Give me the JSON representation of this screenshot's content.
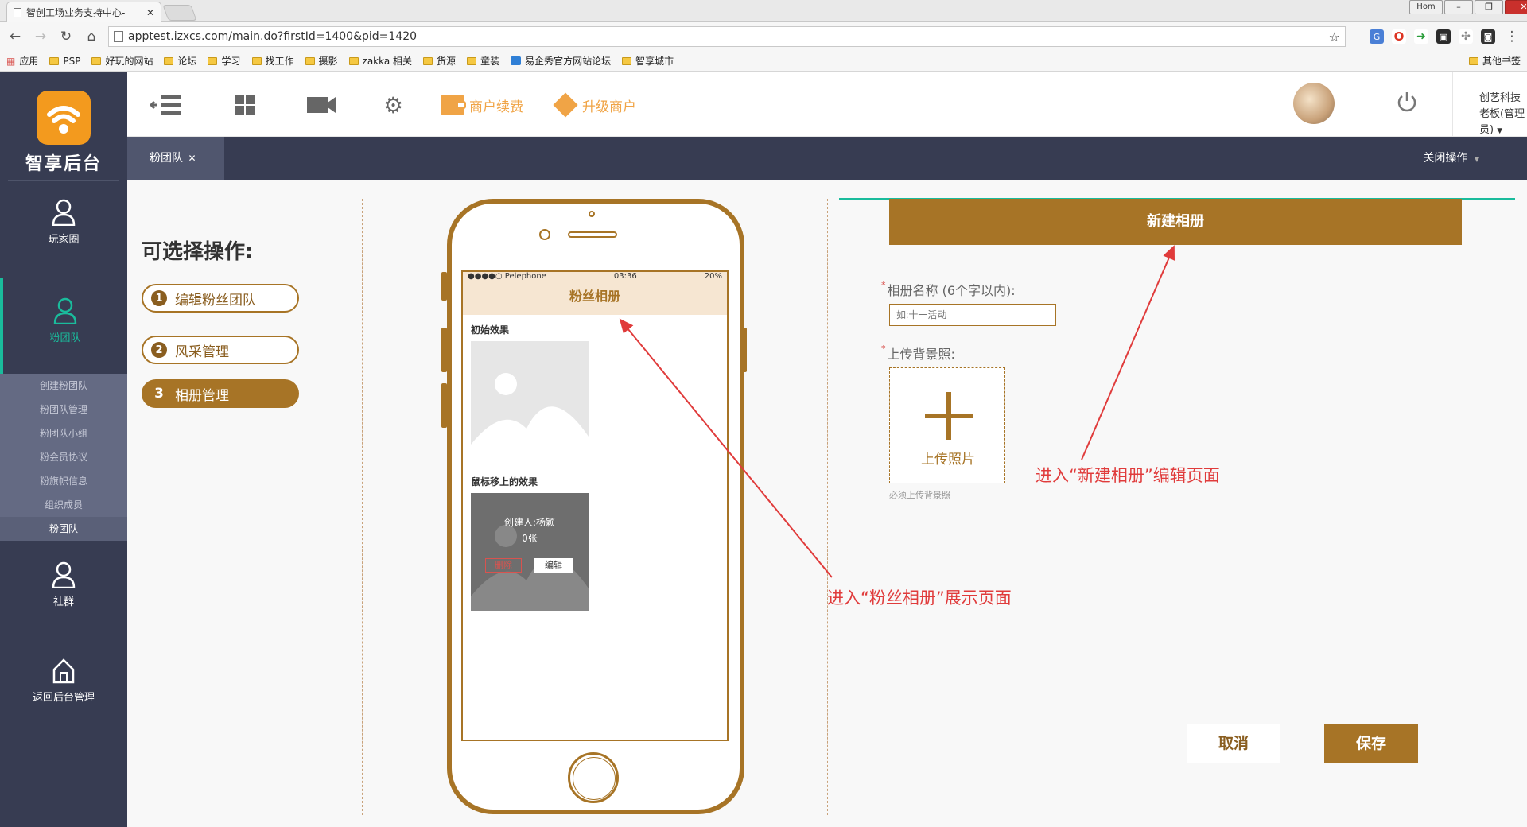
{
  "browser": {
    "tab_title": "智创工场业务支持中心-",
    "window_user": "Hom",
    "url": "apptest.izxcs.com/main.do?firstId=1400&pid=1420",
    "bookmarks": [
      "应用",
      "PSP",
      "好玩的网站",
      "论坛",
      "学习",
      "找工作",
      "摄影",
      "zakka 相关",
      "货源",
      "童装",
      "易企秀官方网站论坛",
      "智享城市"
    ],
    "other_bookmarks": "其他书签"
  },
  "sidebar": {
    "logo_text": "智享后台",
    "items": [
      {
        "label": "玩家圈",
        "icon": "user-icon"
      },
      {
        "label": "粉团队",
        "icon": "user-icon"
      },
      {
        "label": "社群",
        "icon": "user-icon"
      },
      {
        "label": "返回后台管理",
        "icon": "home-icon"
      }
    ],
    "submenu": [
      "创建粉团队",
      "粉团队管理",
      "粉团队小组",
      "粉会员协议",
      "粉旗帜信息",
      "组织成员",
      "粉团队"
    ]
  },
  "topnav": {
    "renew_label": "商户续费",
    "upgrade_label": "升级商户",
    "company": "创艺科技",
    "role": "老板(管理员)"
  },
  "tabs": {
    "current": "粉团队",
    "close_ops": "关闭操作"
  },
  "left_panel": {
    "heading": "可选择操作:",
    "steps": [
      {
        "num": "1",
        "label": "编辑粉丝团队"
      },
      {
        "num": "2",
        "label": "风采管理"
      },
      {
        "num": "3",
        "label": "相册管理"
      }
    ]
  },
  "phone": {
    "carrier": "●●●●○ Pelephone",
    "time": "03:36",
    "battery": "20%",
    "screen_title": "粉丝相册",
    "section1": "初始效果",
    "section2": "鼠标移上的效果",
    "creator": "创建人:杨颖",
    "count": "0张",
    "delete_label": "删除",
    "edit_label": "编辑"
  },
  "form": {
    "banner": "新建相册",
    "name_label": "相册名称 (6个字以内):",
    "name_placeholder": "如:十一活动",
    "bg_label": "上传背景照:",
    "upload_label": "上传照片",
    "upload_hint": "必须上传背景照",
    "cancel_label": "取消",
    "save_label": "保存"
  },
  "annotations": {
    "album_show": "进入“粉丝相册”展示页面",
    "album_edit": "进入“新建相册”编辑页面"
  },
  "colors": {
    "accent": "#a77426",
    "sidebar": "#373c52",
    "teal": "#1abc9c",
    "annotation": "#e03b3b"
  }
}
